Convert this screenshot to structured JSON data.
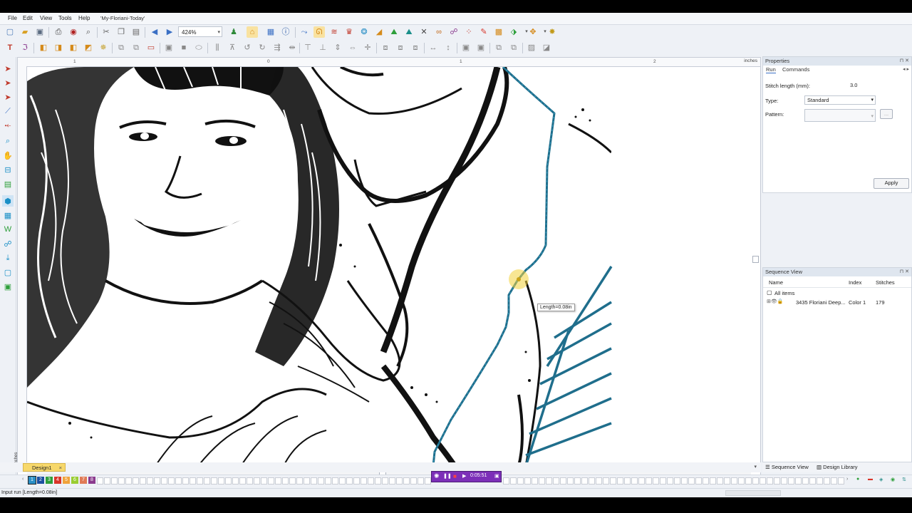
{
  "menu": {
    "items": [
      "File",
      "Edit",
      "View",
      "Tools",
      "Help"
    ],
    "document_title": "'My-Floriani-Today'"
  },
  "toolbar": {
    "zoom_value": "424%"
  },
  "ruler": {
    "unit": "inches",
    "left_unit": "inches",
    "top_ticks": [
      "1",
      "0",
      "1",
      "2"
    ]
  },
  "canvas": {
    "tooltip": "Length=0.08in",
    "stitch_color": "#1f6e8c",
    "cursor_color": "#f2d23a"
  },
  "properties": {
    "title": "Properties",
    "tabs": [
      "Run",
      "Commands"
    ],
    "stitch_length_label": "Stitch length (mm):",
    "stitch_length_value": "3.0",
    "type_label": "Type:",
    "type_value": "Standard",
    "pattern_label": "Pattern:",
    "pattern_value": "",
    "pattern_browse": "...",
    "apply_label": "Apply"
  },
  "sequence": {
    "title": "Sequence View",
    "columns": [
      "Name",
      "Index",
      "Stitches"
    ],
    "all_items": "All items",
    "rows": [
      {
        "name": "3435 Floriani Deep...",
        "index": "Color 1",
        "stitches": "179"
      }
    ]
  },
  "doc_tabs": {
    "design_tab": "Design1",
    "close": "×"
  },
  "panel_tabs": {
    "sequence": "Sequence View",
    "library": "Design Library"
  },
  "color_bar": {
    "swatches": [
      {
        "n": "1",
        "color": "#2a8fc6"
      },
      {
        "n": "2",
        "color": "#1b4fa0"
      },
      {
        "n": "3",
        "color": "#2e9f3b"
      },
      {
        "n": "4",
        "color": "#d9352a"
      },
      {
        "n": "5",
        "color": "#f0a23a"
      },
      {
        "n": "6",
        "color": "#9acd32"
      },
      {
        "n": "7",
        "color": "#e07a56"
      },
      {
        "n": "8",
        "color": "#8b3a8e"
      }
    ]
  },
  "player": {
    "time": "0:05:51"
  },
  "status": {
    "text": "Input run [Length=0.08in]"
  }
}
